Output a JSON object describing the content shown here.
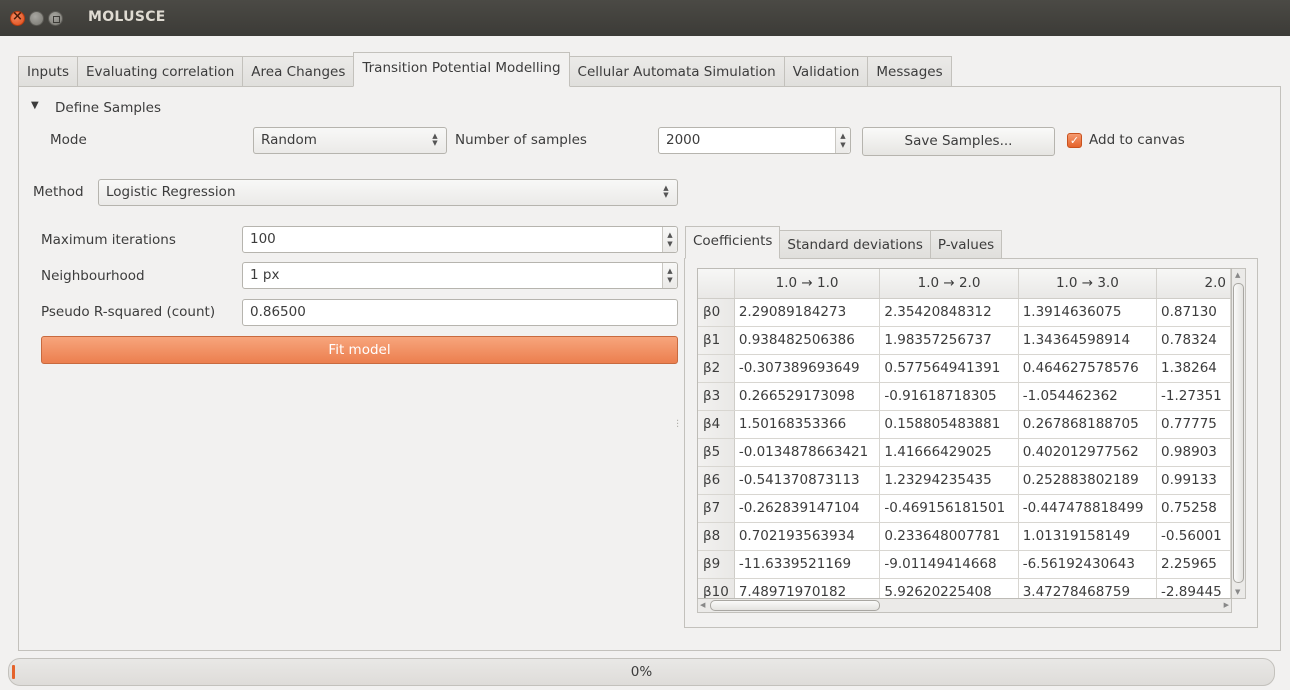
{
  "window": {
    "title": "MOLUSCE"
  },
  "tabs": [
    {
      "label": "Inputs",
      "active": false
    },
    {
      "label": "Evaluating correlation",
      "active": false
    },
    {
      "label": "Area Changes",
      "active": false
    },
    {
      "label": "Transition Potential Modelling",
      "active": true
    },
    {
      "label": "Cellular Automata Simulation",
      "active": false
    },
    {
      "label": "Validation",
      "active": false
    },
    {
      "label": "Messages",
      "active": false
    }
  ],
  "samples": {
    "section_title": "Define Samples",
    "mode_label": "Mode",
    "mode_value": "Random",
    "count_label": "Number of samples",
    "count_value": "2000",
    "save_button": "Save Samples...",
    "add_to_canvas": "Add to canvas",
    "add_to_canvas_checked": true
  },
  "method": {
    "label": "Method",
    "value": "Logistic Regression"
  },
  "params": {
    "max_iter_label": "Maximum iterations",
    "max_iter_value": "100",
    "neighbourhood_label": "Neighbourhood",
    "neighbourhood_value": "1 px",
    "pseudo_r2_label": "Pseudo R-squared (count)",
    "pseudo_r2_value": "0.86500",
    "fit_button": "Fit model"
  },
  "result_tabs": [
    {
      "label": "Coefficients",
      "active": true
    },
    {
      "label": "Standard deviations",
      "active": false
    },
    {
      "label": "P-values",
      "active": false
    }
  ],
  "coefficients": {
    "columns": [
      "1.0 → 1.0",
      "1.0 → 2.0",
      "1.0 → 3.0",
      "2.0"
    ],
    "rows": [
      {
        "label": "β0",
        "cells": [
          "2.29089184273",
          "2.35420848312",
          "1.3914636075",
          "0.87130"
        ]
      },
      {
        "label": "β1",
        "cells": [
          "0.938482506386",
          "1.98357256737",
          "1.34364598914",
          "0.78324"
        ]
      },
      {
        "label": "β2",
        "cells": [
          "-0.307389693649",
          "0.577564941391",
          "0.464627578576",
          "1.38264"
        ]
      },
      {
        "label": "β3",
        "cells": [
          "0.266529173098",
          "-0.91618718305",
          "-1.054462362",
          "-1.27351"
        ]
      },
      {
        "label": "β4",
        "cells": [
          "1.50168353366",
          "0.158805483881",
          "0.267868188705",
          "0.77775"
        ]
      },
      {
        "label": "β5",
        "cells": [
          "-0.0134878663421",
          "1.41666429025",
          "0.402012977562",
          "0.98903"
        ]
      },
      {
        "label": "β6",
        "cells": [
          "-0.541370873113",
          "1.23294235435",
          "0.252883802189",
          "0.99133"
        ]
      },
      {
        "label": "β7",
        "cells": [
          "-0.262839147104",
          "-0.469156181501",
          "-0.447478818499",
          "0.75258"
        ]
      },
      {
        "label": "β8",
        "cells": [
          "0.702193563934",
          "0.233648007781",
          "1.01319158149",
          "-0.56001"
        ]
      },
      {
        "label": "β9",
        "cells": [
          "-11.6339521169",
          "-9.01149414668",
          "-6.56192430643",
          "2.25965"
        ]
      },
      {
        "label": "β10",
        "cells": [
          "7.48971970182",
          "5.92620225408",
          "3.47278468759",
          "-2.89445"
        ]
      }
    ]
  },
  "progress": {
    "text": "0%",
    "fraction": 0.0
  },
  "colors": {
    "accent": "#e5632b",
    "titlebar": "#3c3b37",
    "background": "#f2f1f0"
  }
}
